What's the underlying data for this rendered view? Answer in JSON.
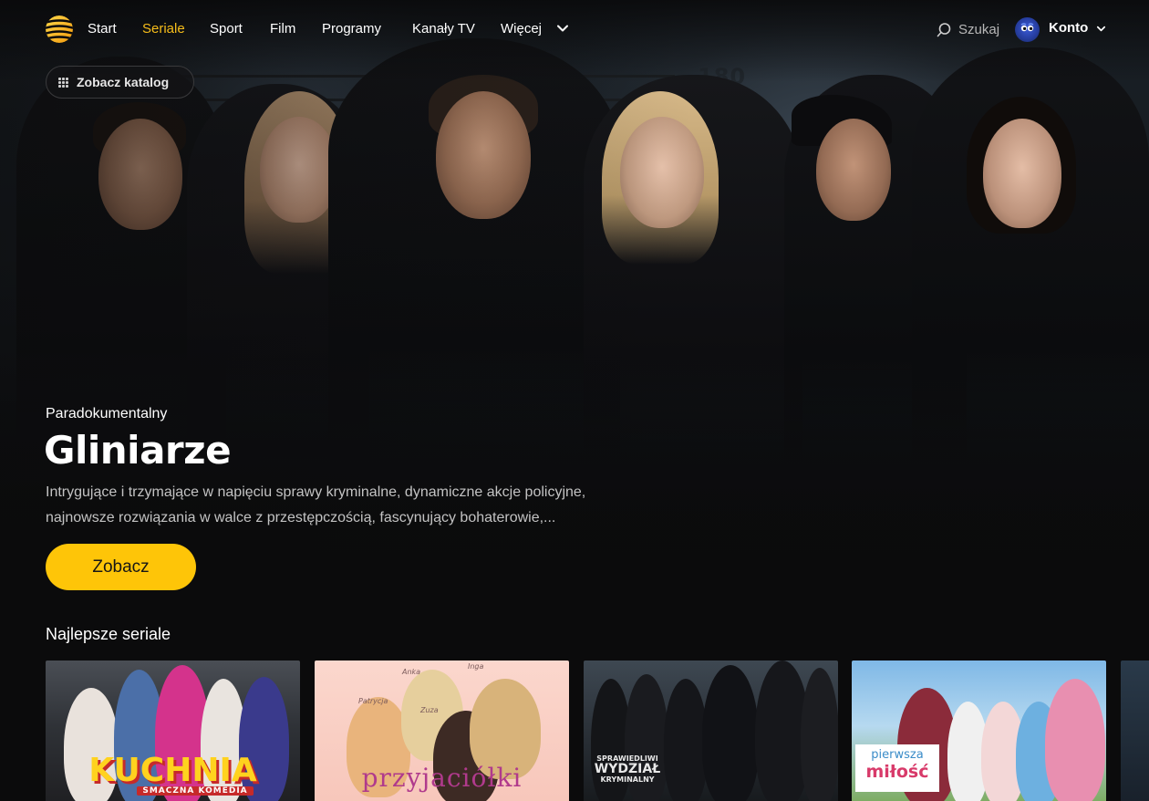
{
  "nav": {
    "logo_icon": "sun-stripes-logo",
    "items": [
      {
        "label": "Start",
        "active": false
      },
      {
        "label": "Seriale",
        "active": true
      },
      {
        "label": "Sport",
        "active": false
      },
      {
        "label": "Film",
        "active": false
      },
      {
        "label": "Programy",
        "active": false
      },
      {
        "label": "Kanały TV",
        "active": false
      },
      {
        "label": "Więcej",
        "active": false
      }
    ],
    "search_label": "Szukaj",
    "account_label": "Konto",
    "accent_color": "#f6bd1a"
  },
  "catalog_button": {
    "label": "Zobacz katalog",
    "icon": "grid-icon"
  },
  "hero": {
    "height_marks": [
      "180",
      "170",
      "160"
    ],
    "genre": "Paradokumentalny",
    "title": "Gliniarze",
    "description_line1": "Intrygujące i trzymające w napięciu sprawy kryminalne, dynamiczne akcje policyjne,",
    "description_line2": "najnowsze rozwiązania w walce z przestępczością, fascynujący bohaterowie,...",
    "cta_label": "Zobacz",
    "cta_color": "#fec508"
  },
  "row": {
    "title": "Najlepsze seriale",
    "tiles": [
      {
        "title": "KUCHNIA",
        "subtitle": "SMACZNA KOMEDIA"
      },
      {
        "title": "przyjaciółki",
        "names": [
          "Patrycja",
          "Anka",
          "Inga",
          "Zuza"
        ]
      },
      {
        "title_line1": "SPRAWIEDLIWI",
        "title_line2": "WYDZIAŁ",
        "title_line3": "KRYMINALNY"
      },
      {
        "title_line1": "pierwsza",
        "title_line2": "miłość"
      }
    ]
  }
}
